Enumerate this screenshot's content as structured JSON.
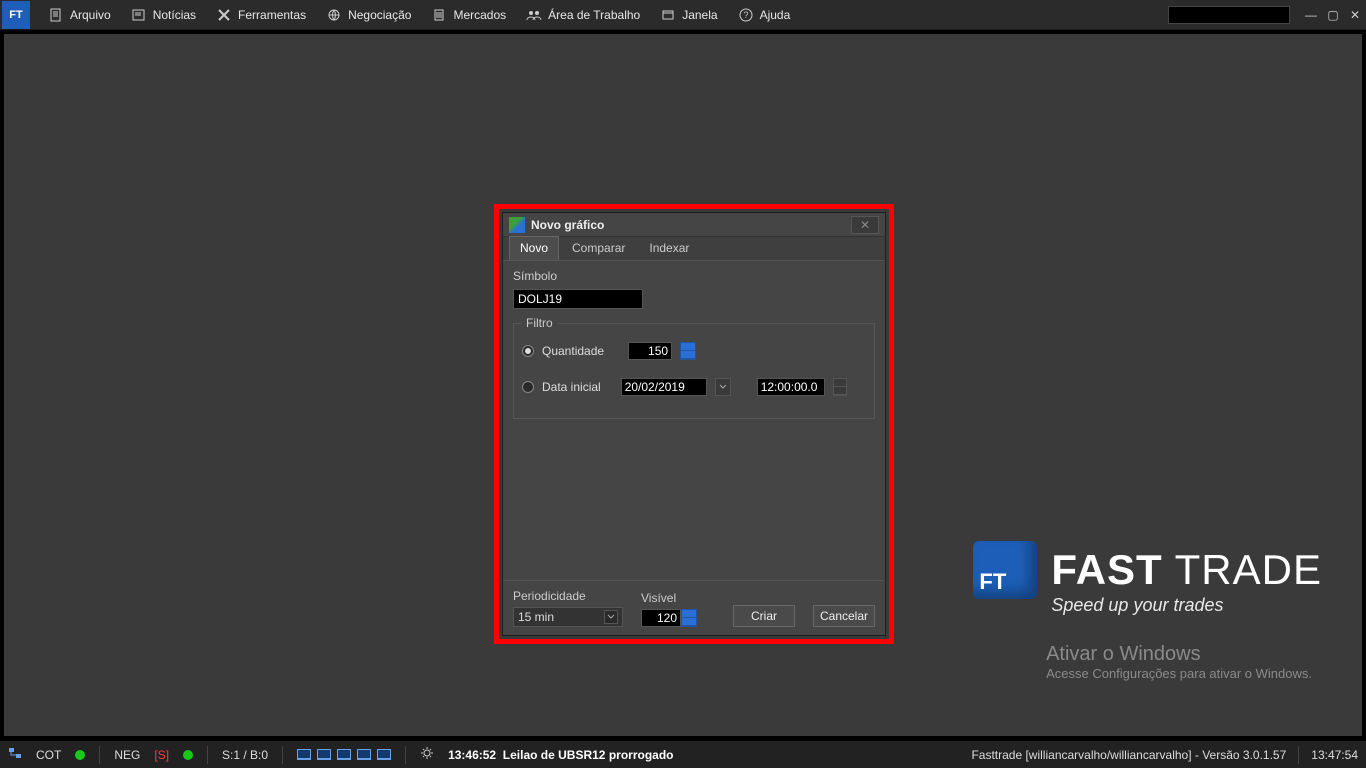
{
  "app": {
    "logo": "FT"
  },
  "menu": {
    "arquivo": "Arquivo",
    "noticias": "Notícias",
    "ferramentas": "Ferramentas",
    "negociacao": "Negociação",
    "mercados": "Mercados",
    "area": "Área de Trabalho",
    "janela": "Janela",
    "ajuda": "Ajuda"
  },
  "dialog": {
    "title": "Novo gráfico",
    "tabs": {
      "novo": "Novo",
      "comparar": "Comparar",
      "indexar": "Indexar"
    },
    "simbolo_label": "Símbolo",
    "simbolo_value": "DOLJ19",
    "filtro_legend": "Filtro",
    "quantidade_label": "Quantidade",
    "quantidade_value": "150",
    "datainicial_label": "Data inicial",
    "datainicial_value": "20/02/2019",
    "timeinicial_value": "12:00:00.0",
    "periodicidade_label": "Periodicidade",
    "periodicidade_value": "15 min",
    "visivel_label": "Visível",
    "visivel_value": "120",
    "criar": "Criar",
    "cancelar": "Cancelar"
  },
  "brand": {
    "cube": "FT",
    "bold": "FAST",
    "light": "TRADE",
    "slogan": "Speed up your trades"
  },
  "activate": {
    "line1": "Ativar o Windows",
    "line2": "Acesse Configurações para ativar o Windows."
  },
  "status": {
    "cot": "COT",
    "neg": "NEG",
    "neg_s": "[S]",
    "sb": "S:1 / B:0",
    "msg_time": "13:46:52",
    "msg_text": "Leilao de UBSR12 prorrogado",
    "right": "Fasttrade [williancarvalho/williancarvalho] - Versão 3.0.1.57",
    "clock": "13:47:54"
  }
}
